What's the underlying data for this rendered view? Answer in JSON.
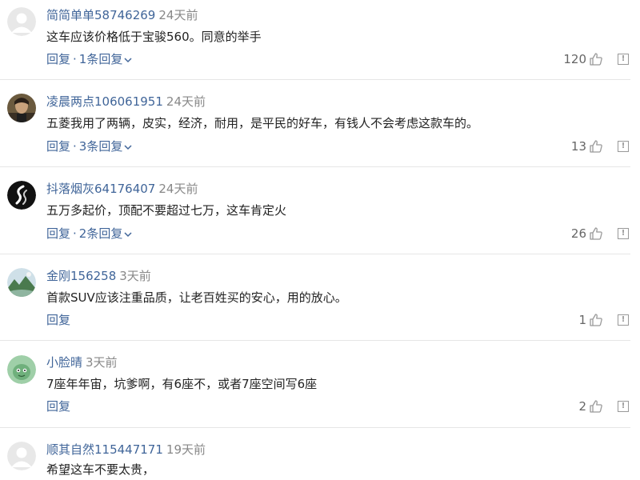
{
  "comments": [
    {
      "username": "简简单单58746269",
      "time": "24天前",
      "content": "这车应该价格低于宝骏560。同意的举手",
      "reply_label": "回复",
      "more_replies": "1条回复",
      "likes": "120",
      "avatar": "default-avatar"
    },
    {
      "username": "凌晨两点106061951",
      "time": "24天前",
      "content": "五菱我用了两辆，皮实，经济，耐用，是平民的好车，有钱人不会考虑这款车的。",
      "reply_label": "回复",
      "more_replies": "3条回复",
      "likes": "13",
      "avatar": "photo-avatar"
    },
    {
      "username": "抖落烟灰64176407",
      "time": "24天前",
      "content": "五万多起价，顶配不要超过七万，这车肯定火",
      "reply_label": "回复",
      "more_replies": "2条回复",
      "likes": "26",
      "avatar": "swirl-avatar"
    },
    {
      "username": "金刚156258",
      "time": "3天前",
      "content": "首款SUV应该注重品质，让老百姓买的安心，用的放心。",
      "reply_label": "回复",
      "likes": "1",
      "avatar": "landscape-avatar"
    },
    {
      "username": "小脸晴",
      "time": "3天前",
      "content": "7座年年宙，坑爹啊，有6座不，或者7座空间写6座",
      "reply_label": "回复",
      "likes": "2",
      "avatar": "cartoon-avatar"
    },
    {
      "username": "顺其自然115447171",
      "time": "19天前",
      "content": "希望这车不要太贵，",
      "avatar": "default-avatar"
    }
  ],
  "separator": "·",
  "colors": {
    "link": "#406599",
    "meta": "#888888",
    "divider": "#e6e6e6"
  }
}
